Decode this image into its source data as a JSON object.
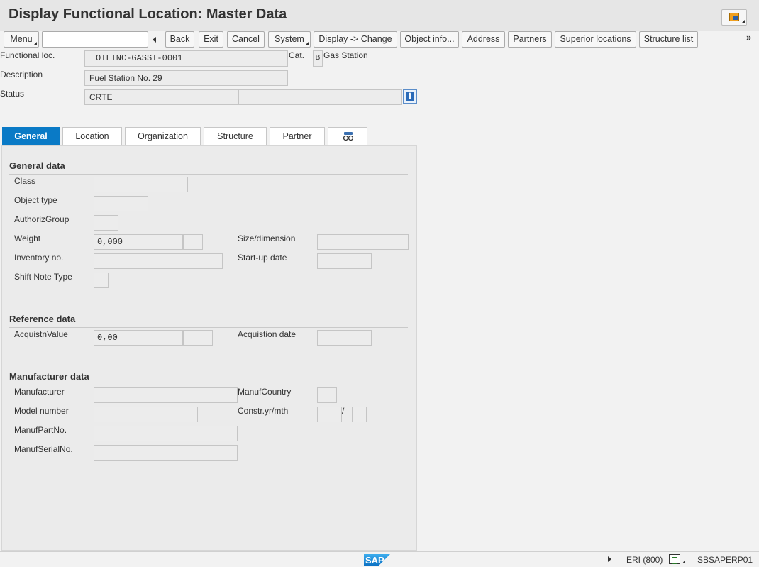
{
  "window": {
    "title": "Display Functional Location: Master Data"
  },
  "toolbar": {
    "menu": "Menu",
    "back": "Back",
    "exit": "Exit",
    "cancel": "Cancel",
    "system": "System",
    "display_change": "Display -> Change",
    "object_info": "Object info...",
    "address": "Address",
    "partners": "Partners",
    "superior_locations": "Superior locations",
    "structure_list": "Structure list",
    "command_value": "",
    "more": "»"
  },
  "header": {
    "functional_loc_label": "Functional loc.",
    "functional_loc_value": "OILINC-GASST-0001",
    "cat_label": "Cat.",
    "cat_value": "B",
    "cat_text": "Gas Station",
    "description_label": "Description",
    "description_value": "Fuel Station No. 29",
    "status_label": "Status",
    "status_value": "CRTE",
    "status_value2": ""
  },
  "tabs": [
    {
      "label": "General",
      "active": true
    },
    {
      "label": "Location",
      "active": false
    },
    {
      "label": "Organization",
      "active": false
    },
    {
      "label": "Structure",
      "active": false
    },
    {
      "label": "Partner",
      "active": false
    }
  ],
  "general_data": {
    "title": "General data",
    "class_label": "Class",
    "class_value": "",
    "object_type_label": "Object type",
    "object_type_value": "",
    "authoriz_group_label": "AuthorizGroup",
    "authoriz_group_value": "",
    "weight_label": "Weight",
    "weight_value": "0,000",
    "weight_unit": "",
    "size_label": "Size/dimension",
    "size_value": "",
    "inventory_label": "Inventory no.",
    "inventory_value": "",
    "startup_label": "Start-up date",
    "startup_value": "",
    "shift_note_label": "Shift Note Type",
    "shift_note_value": ""
  },
  "reference_data": {
    "title": "Reference data",
    "acq_value_label": "AcquistnValue",
    "acq_value": "0,00",
    "acq_currency": "",
    "acq_date_label": "Acquistion date",
    "acq_date_value": ""
  },
  "manufacturer_data": {
    "title": "Manufacturer data",
    "manufacturer_label": "Manufacturer",
    "manufacturer_value": "",
    "country_label": "ManufCountry",
    "country_value": "",
    "model_label": "Model number",
    "model_value": "",
    "constr_label": "Constr.yr/mth",
    "constr_year": "",
    "constr_sep": "/",
    "constr_month": "",
    "part_label": "ManufPartNo.",
    "part_value": "",
    "serial_label": "ManufSerialNo.",
    "serial_value": ""
  },
  "statusbar": {
    "system": "ERI (800)",
    "server": "SBSAPERP01",
    "logo": "SAP"
  },
  "colors": {
    "tab_active": "#0a7ac6",
    "info_icon": "#2a6ab8",
    "sap_logo": "#1f8de0"
  }
}
